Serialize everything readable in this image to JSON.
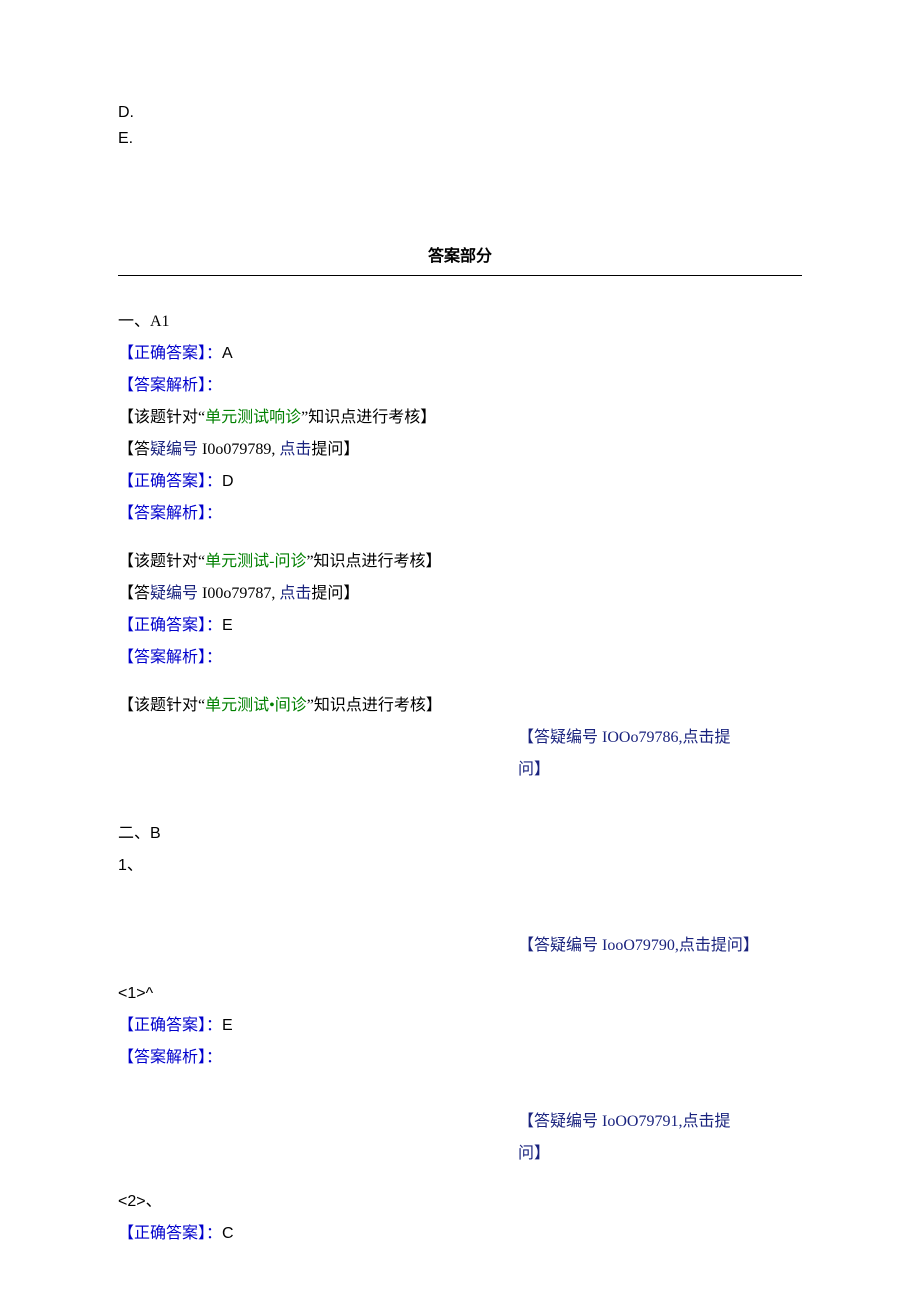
{
  "options": {
    "d": "D.",
    "e": "E."
  },
  "answer_section_title": "答案部分",
  "labels": {
    "correct": "【正确答案】：",
    "analysis": "【答案解析】：",
    "topic_open": "【该题针对“",
    "topic_close_1": "”知识点进行考核】",
    "qa_open": "【答",
    "qa_mid": "疑编号 ",
    "qa_click_space": ", ",
    "qa_click": "点击",
    "qa_ask": "提问】",
    "qa_open_full": "【答疑编号 ",
    "qa_click_nospace": ",点击",
    "qa_ask_full": "提问】",
    "ask": "问】"
  },
  "a1": {
    "header": "一、A1",
    "q1": {
      "answer": "A",
      "topic": "单元测试响诊",
      "qid": "I0o079789"
    },
    "q2": {
      "answer": "D",
      "topic": "单元测试-问诊",
      "qid": "I00o79787"
    },
    "q3": {
      "answer": "E",
      "topic": "单元测试•间诊",
      "qid_head": "IOOo79786,",
      "qid_tail": "点击提"
    }
  },
  "b": {
    "header": "二、B",
    "num1": "1、",
    "qa1": {
      "qid": "IooO79790",
      "click": ",点击提问】"
    },
    "sub1": {
      "head": "<1>^",
      "answer": "E"
    },
    "qa2": {
      "qid": "IoOO79791",
      "click": ",点击提"
    },
    "sub2": {
      "head": "<2>、",
      "answer": "C"
    }
  }
}
